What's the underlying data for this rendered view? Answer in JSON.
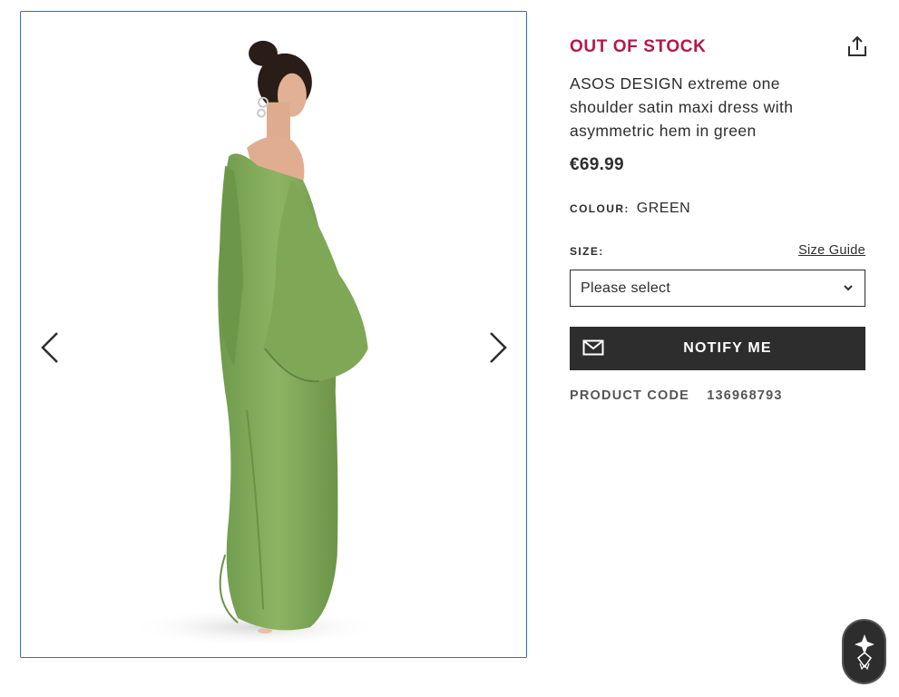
{
  "gallery": {
    "image_alt": "",
    "prev_icon": "chevron-left-icon",
    "next_icon": "chevron-right-icon"
  },
  "product": {
    "stock_status": "OUT OF STOCK",
    "title": "ASOS DESIGN extreme one shoulder satin maxi dress with asymmetric hem in green",
    "price": "€69.99",
    "colour_label": "COLOUR:",
    "colour_value": "GREEN",
    "size_label": "SIZE:",
    "size_guide": "Size Guide",
    "size_select": "Please select",
    "notify_button": "NOTIFY ME",
    "product_code_label": "PRODUCT CODE",
    "product_code": "136968793"
  },
  "icons": {
    "share": "share-icon",
    "mail": "mail-icon",
    "chevron": "chevron-down-icon",
    "helper": "assistant-icon"
  },
  "colors": {
    "stock_status": "#b5164b",
    "text": "#2d2d2d",
    "button_bg": "#2d2d2d",
    "gallery_border": "#2b6fbf"
  }
}
